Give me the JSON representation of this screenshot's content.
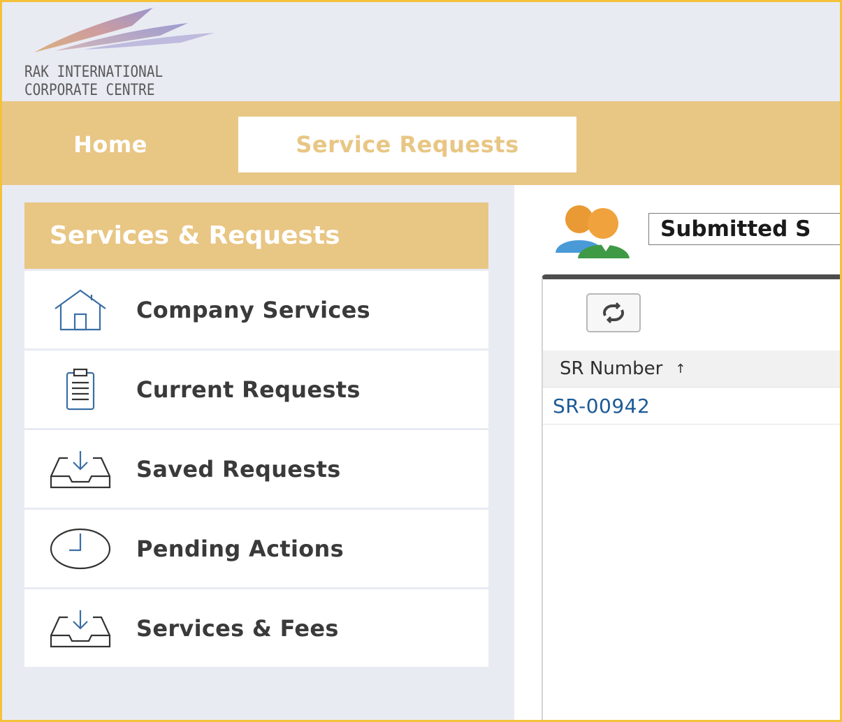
{
  "logo": {
    "line1": "RAK INTERNATIONAL",
    "line2": "CORPORATE CENTRE"
  },
  "nav": {
    "tabs": [
      {
        "label": "Home",
        "active": false
      },
      {
        "label": "Service Requests",
        "active": true
      }
    ]
  },
  "sidebar": {
    "title": "Services & Requests",
    "items": [
      {
        "label": "Company Services",
        "icon": "house-icon"
      },
      {
        "label": "Current Requests",
        "icon": "clipboard-icon"
      },
      {
        "label": "Saved Requests",
        "icon": "inbox-tray-icon"
      },
      {
        "label": "Pending Actions",
        "icon": "clock-icon"
      },
      {
        "label": "Services & Fees",
        "icon": "inbox-tray-icon"
      }
    ]
  },
  "main": {
    "view_select_value": "Submitted S",
    "table": {
      "columns": [
        "SR Number"
      ],
      "sort_indicator": "↑",
      "rows": [
        {
          "sr_number": "SR-00942"
        }
      ]
    }
  },
  "colors": {
    "accent": "#e8c684",
    "frame_border": "#f3c23a",
    "background": "#e9ebf3",
    "link": "#1d5a96"
  }
}
